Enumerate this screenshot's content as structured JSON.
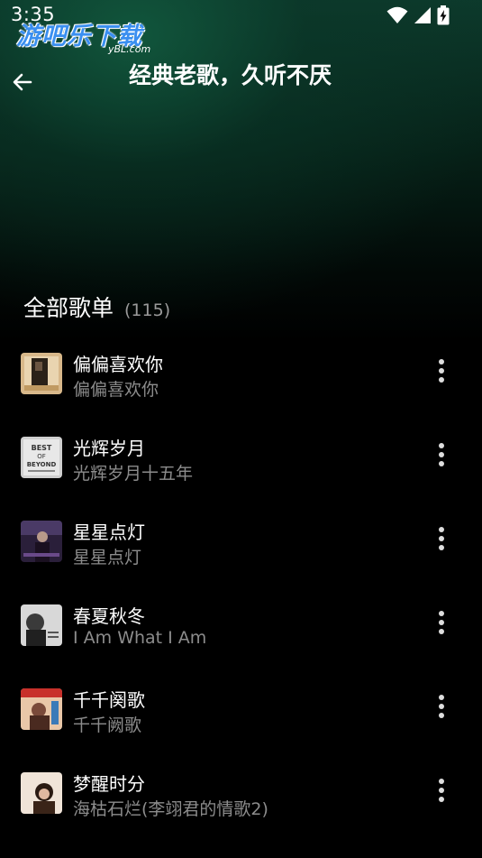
{
  "status_bar": {
    "time": "3:35",
    "icons": [
      "wifi-icon",
      "cellular-signal-icon",
      "battery-charging-icon"
    ]
  },
  "watermark": {
    "main": "游吧乐下载",
    "sub": "yBL.com"
  },
  "header": {
    "back_icon": "arrow-left-icon",
    "title": "经典老歌，久听不厌"
  },
  "section": {
    "title": "全部歌单",
    "count": "(115)"
  },
  "playlist": [
    {
      "title": "偏偏喜欢你",
      "subtitle": "偏偏喜欢你",
      "cover": "album-cover-warm"
    },
    {
      "title": "光辉岁月",
      "subtitle": "光辉岁月十五年",
      "cover": "album-cover-best-of-beyond"
    },
    {
      "title": "星星点灯",
      "subtitle": "星星点灯",
      "cover": "album-cover-purple"
    },
    {
      "title": "春夏秋冬",
      "subtitle": "I Am What I Am",
      "cover": "album-cover-bw"
    },
    {
      "title": "千千阕歌",
      "subtitle": "千千阙歌",
      "cover": "album-cover-red"
    },
    {
      "title": "梦醒时分",
      "subtitle": "海枯石烂(李翊君的情歌2)",
      "cover": "album-cover-portrait"
    }
  ],
  "colors": {
    "background": "#000000",
    "header_gradient": "#0d3a2c",
    "primary_text": "#ffffff",
    "secondary_text": "#8c8c8c",
    "watermark": "#3a8ff0"
  }
}
